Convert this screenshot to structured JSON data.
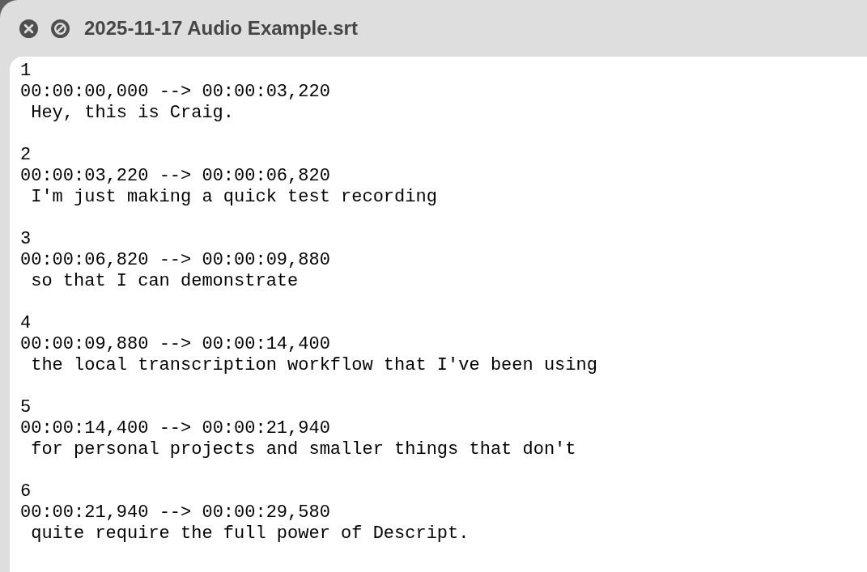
{
  "window": {
    "title": "2025-11-17 Audio Example.srt"
  },
  "entries": [
    {
      "index": "1",
      "timing": "00:00:00,000 --> 00:00:03,220",
      "text": "Hey, this is Craig."
    },
    {
      "index": "2",
      "timing": "00:00:03,220 --> 00:00:06,820",
      "text": "I'm just making a quick test recording"
    },
    {
      "index": "3",
      "timing": "00:00:06,820 --> 00:00:09,880",
      "text": "so that I can demonstrate"
    },
    {
      "index": "4",
      "timing": "00:00:09,880 --> 00:00:14,400",
      "text": "the local transcription workflow that I've been using"
    },
    {
      "index": "5",
      "timing": "00:00:14,400 --> 00:00:21,940",
      "text": "for personal projects and smaller things that don't"
    },
    {
      "index": "6",
      "timing": "00:00:21,940 --> 00:00:29,580",
      "text": "quite require the full power of Descript."
    }
  ]
}
